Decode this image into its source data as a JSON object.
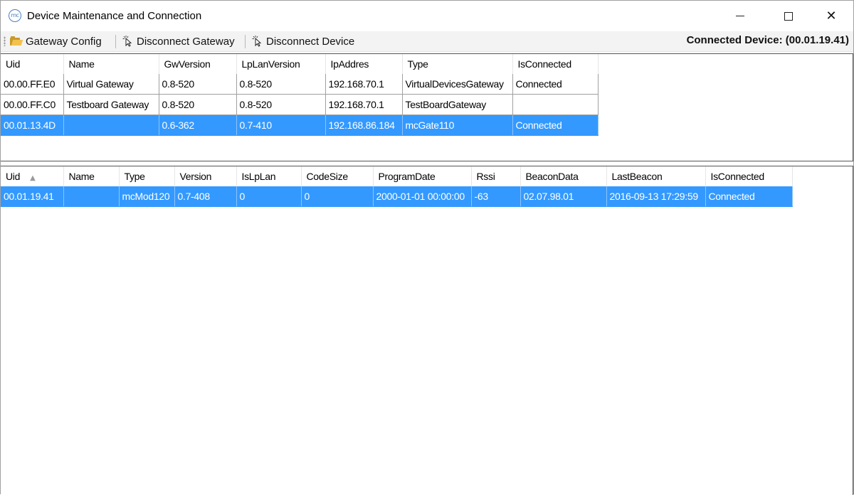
{
  "window": {
    "title": "Device Maintenance and Connection",
    "icon_text": "mc",
    "controls": {
      "minimize": "minimize-icon",
      "maximize": "maximize-icon",
      "close": "close-icon"
    }
  },
  "toolbar": {
    "gateway_config": "Gateway Config",
    "disconnect_gateway": "Disconnect Gateway",
    "disconnect_device": "Disconnect Device",
    "connected_device": "Connected Device: (00.01.19.41)"
  },
  "gateways": {
    "columns": [
      "Uid",
      "Name",
      "GwVersion",
      "LpLanVersion",
      "IpAddres",
      "Type",
      "IsConnected"
    ],
    "rows": [
      [
        "00.00.FF.E0",
        "Virtual Gateway",
        "0.8-520",
        "0.8-520",
        "192.168.70.1",
        "VirtualDevicesGateway",
        "Connected"
      ],
      [
        "00.00.FF.C0",
        "Testboard Gateway",
        "0.8-520",
        "0.8-520",
        "192.168.70.1",
        "TestBoardGateway",
        ""
      ],
      [
        "00.01.13.4D",
        "",
        "0.6-362",
        "0.7-410",
        "192.168.86.184",
        "mcGate110",
        "Connected"
      ]
    ],
    "selected_row": 2
  },
  "devices": {
    "columns": [
      "Uid",
      "Name",
      "Type",
      "Version",
      "IsLpLan",
      "CodeSize",
      "ProgramDate",
      "Rssi",
      "BeaconData",
      "LastBeacon",
      "IsConnected"
    ],
    "sort_indicator": "▲",
    "rows": [
      [
        "00.01.19.41",
        "",
        "mcMod120",
        "0.7-408",
        "0",
        "0",
        "2000-01-01 00:00:00",
        "-63",
        "02.07.98.01",
        "2016-09-13 17:29:59",
        "Connected"
      ]
    ],
    "selected_row": 0
  },
  "colors": {
    "selection": "#3399ff",
    "toolbar_bg": "#f3f3f3"
  }
}
